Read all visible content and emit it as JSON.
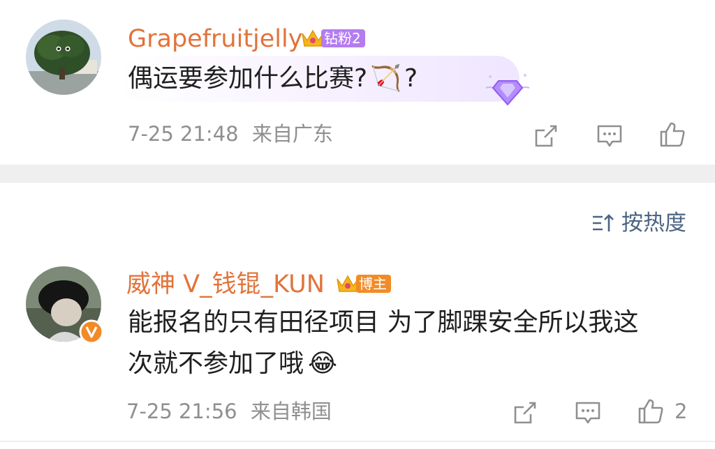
{
  "comments": [
    {
      "username": "Grapefruitjelly",
      "badge": "钻粉2",
      "text": "偶运要参加什么比赛?",
      "emoji_inline": "🏹",
      "text_suffix": "?",
      "time": "7-25 21:48",
      "location": "来自广东",
      "likes": ""
    },
    {
      "username": "威神 V_钱锟_KUN",
      "badge": "博主",
      "text_line1": "能报名的只有田径项目 为了脚踝安全所以我这",
      "text_line2": "次就不参加了哦",
      "emoji_inline": "😂",
      "time": "7-25 21:56",
      "location": "来自韩国",
      "likes": "2"
    }
  ],
  "sort": {
    "label": "按热度"
  },
  "icons": [
    "share-icon",
    "comment-icon",
    "like-icon",
    "sort-icon",
    "crown-icon",
    "verified-icon",
    "diamond-sticker-icon"
  ],
  "colors": {
    "username": "#e2733a",
    "meta": "#8f8f8f",
    "sort": "#4b6483",
    "divider": "#efefef",
    "badge_purple": "#b47cf0",
    "badge_orange": "#f28b26"
  }
}
